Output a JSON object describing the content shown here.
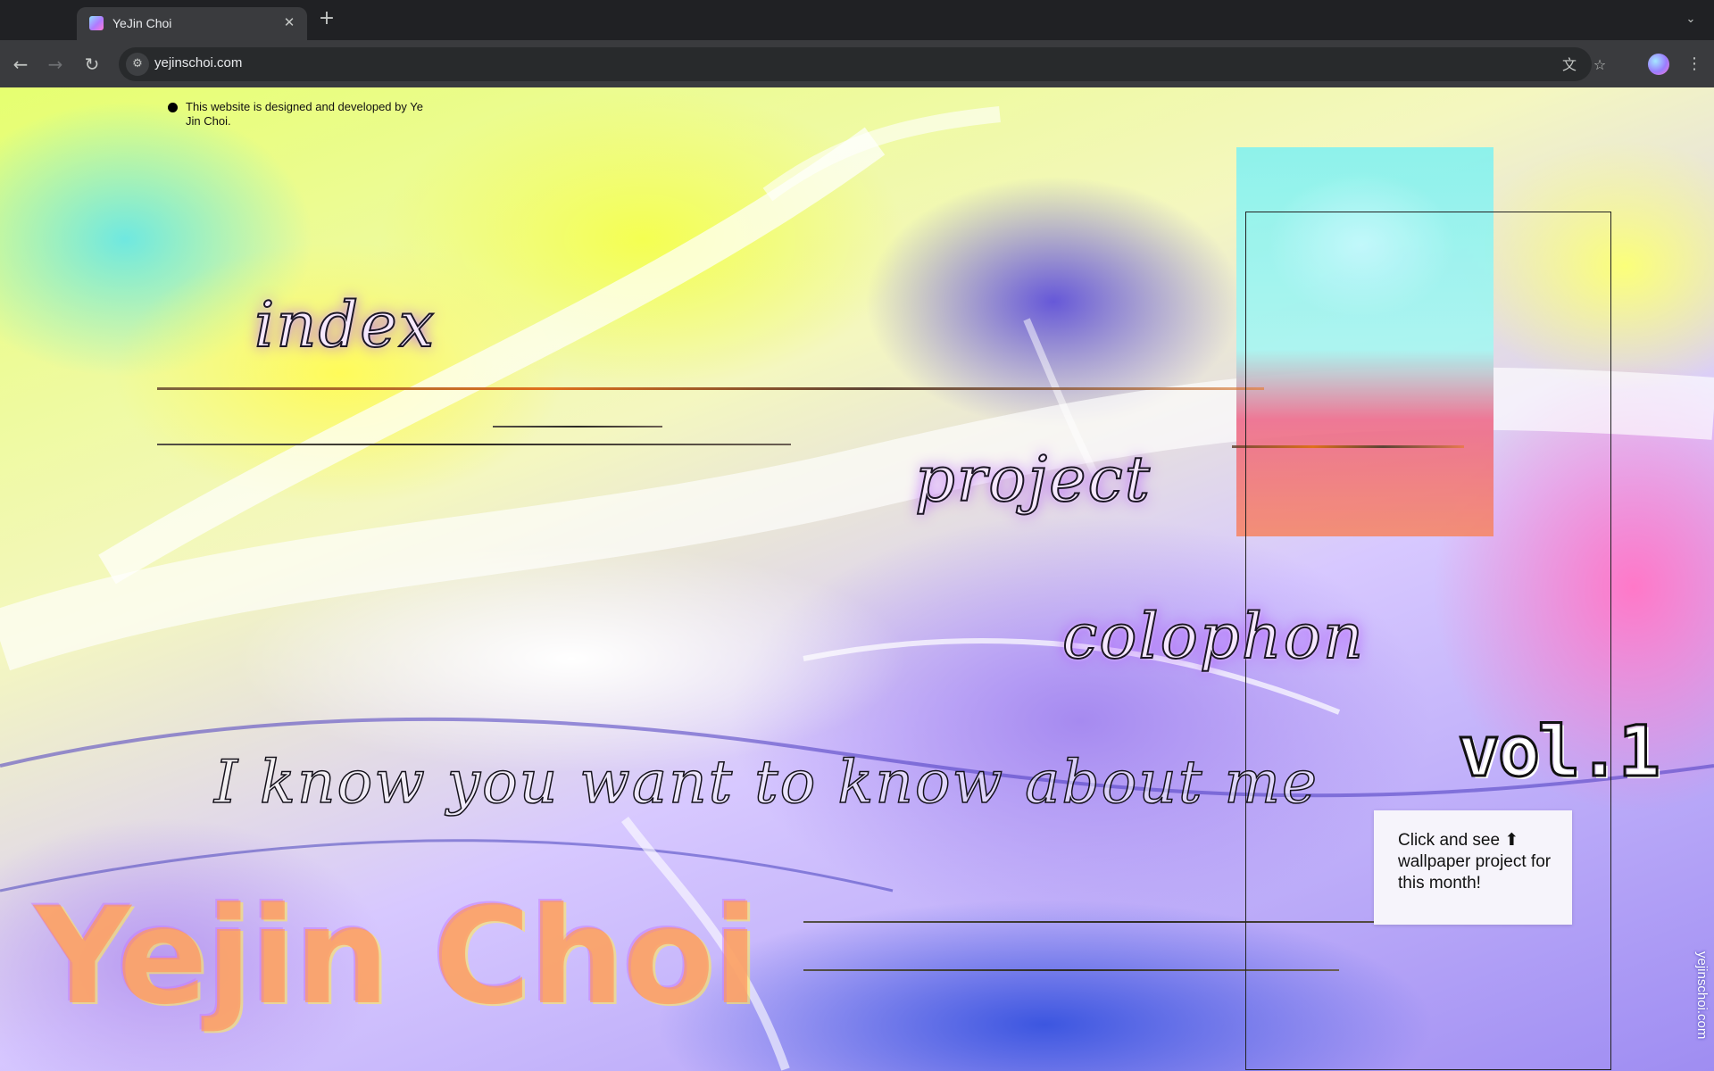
{
  "browser": {
    "tab": {
      "title": "YeJin Choi",
      "close_glyph": "✕"
    },
    "new_tab_glyph": "+",
    "tab_search_glyph": "⌄",
    "toolbar": {
      "back_glyph": "←",
      "forward_glyph": "→",
      "reload_glyph": "↻",
      "site_info_glyph": "⚙",
      "url": "yejinschoi.com",
      "translate_glyph": "文",
      "bookmark_glyph": "☆",
      "menu_glyph": "⋮"
    }
  },
  "page": {
    "credit": "This website is designed and developed by Ye Jin Choi.",
    "nav": {
      "index": "index",
      "project": "project",
      "colophon": "colophon"
    },
    "tagline": "I know you want to know about me",
    "vol_badge": "vol.1",
    "promo": "Click and see ⬆ wallpaper project for this month!",
    "signature": "Yejin Choi",
    "side_url": "yejinschoi.com"
  },
  "colors": {
    "chrome_bg": "#202124",
    "toolbar_bg": "#3a3b3e",
    "accent_glow": "#b04dff",
    "signature": "#ff9660"
  }
}
